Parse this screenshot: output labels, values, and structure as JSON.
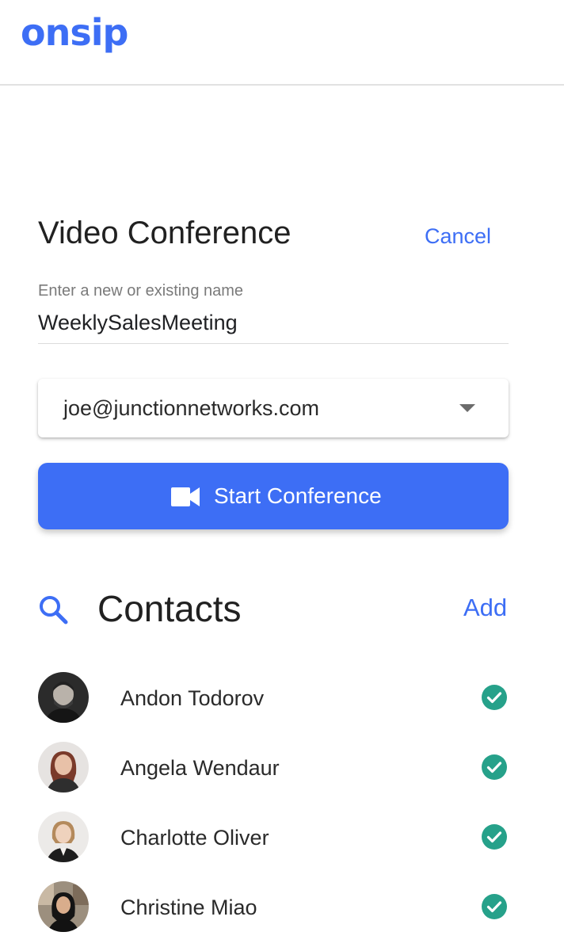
{
  "header": {
    "logo_text": "onsip"
  },
  "video_conference": {
    "title": "Video Conference",
    "cancel_label": "Cancel",
    "name_field": {
      "label": "Enter a new or existing name",
      "value": "WeeklySalesMeeting"
    },
    "account_select": {
      "selected": "joe@junctionnetworks.com",
      "icon": "chevron-down-icon"
    },
    "start_button": {
      "label": "Start Conference",
      "icon": "video-camera-icon"
    }
  },
  "contacts": {
    "title": "Contacts",
    "search_icon": "search-icon",
    "add_label": "Add",
    "items": [
      {
        "name": "Andon Todorov",
        "status": "available",
        "status_icon": "check-circle-icon"
      },
      {
        "name": "Angela Wendaur",
        "status": "available",
        "status_icon": "check-circle-icon"
      },
      {
        "name": "Charlotte Oliver",
        "status": "available",
        "status_icon": "check-circle-icon"
      },
      {
        "name": "Christine Miao",
        "status": "available",
        "status_icon": "check-circle-icon"
      }
    ]
  },
  "colors": {
    "brand": "#3d6ef5",
    "status_available": "#26a18a",
    "divider": "#e2e2e2"
  }
}
